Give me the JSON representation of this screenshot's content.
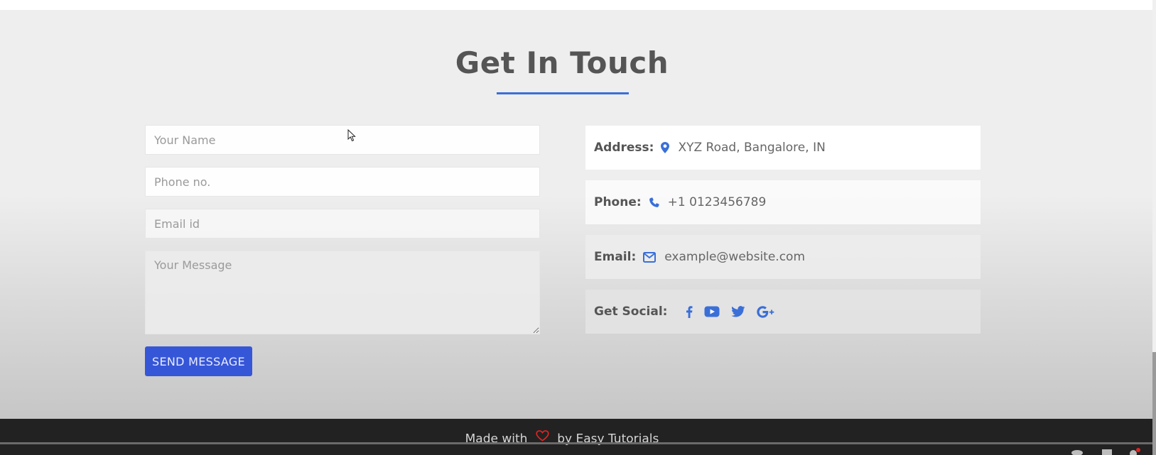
{
  "title": "Get In Touch",
  "form": {
    "name_placeholder": "Your Name",
    "phone_placeholder": "Phone no.",
    "email_placeholder": "Email id",
    "message_placeholder": "Your Message",
    "submit_label": "SEND MESSAGE"
  },
  "info": {
    "address_label": "Address:",
    "address_value": "XYZ Road, Bangalore, IN",
    "phone_label": "Phone:",
    "phone_value": "+1 0123456789",
    "email_label": "Email:",
    "email_value": "example@website.com",
    "social_label": "Get Social:"
  },
  "icons": {
    "address": "map-marker-icon",
    "phone": "phone-icon",
    "email": "envelope-icon",
    "social": [
      "facebook-icon",
      "youtube-icon",
      "twitter-icon",
      "google-plus-icon"
    ]
  },
  "footer": {
    "text_before": "Made with",
    "text_after": "by Easy Tutorials"
  },
  "colors": {
    "accent": "#3a6fd8",
    "button": "#3656d8",
    "heart": "#e02424",
    "footer_bg": "#222222"
  }
}
